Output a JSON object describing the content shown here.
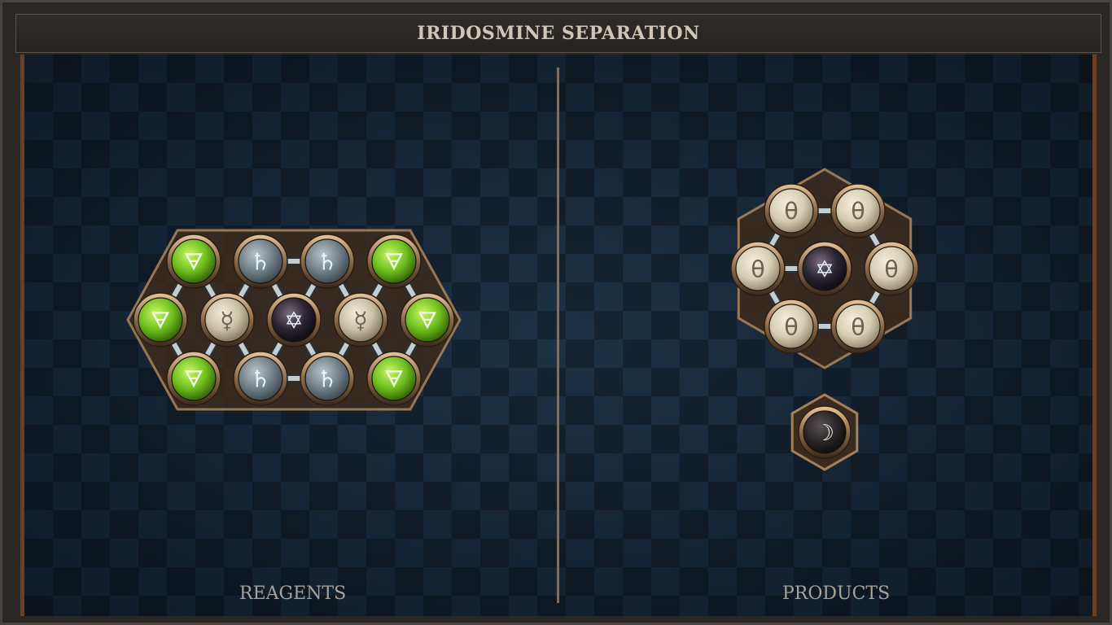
{
  "title": "IRIDOSMINE SEPARATION",
  "panels": {
    "reagents_label": "REAGENTS",
    "products_label": "PRODUCTS"
  },
  "colors": {
    "board": "#142231",
    "frame_accent": "#6b3f24",
    "atom_salt_earth": "#7fd12a",
    "atom_lead": "#8e9ba0",
    "atom_quicksilver": "#d8d0b5",
    "atom_quintessence": "#3a3440",
    "atom_salt": "#e0d8c0",
    "bond": "#b9c3c6"
  },
  "reagent_molecule": {
    "atoms": [
      {
        "id": "r1",
        "element": "earth",
        "glyph": "🜃",
        "col": 0,
        "row": 0
      },
      {
        "id": "r2",
        "element": "lead",
        "glyph": "♄",
        "col": 1,
        "row": 0
      },
      {
        "id": "r3",
        "element": "lead",
        "glyph": "♄",
        "col": 2,
        "row": 0
      },
      {
        "id": "r4",
        "element": "earth",
        "glyph": "🜃",
        "col": 3,
        "row": 0
      },
      {
        "id": "r5",
        "element": "earth",
        "glyph": "🜃",
        "col": 0,
        "row": 1
      },
      {
        "id": "r6",
        "element": "quicksilver",
        "glyph": "☿",
        "col": 1,
        "row": 1
      },
      {
        "id": "r7",
        "element": "aether",
        "glyph": "✡",
        "col": 2,
        "row": 1
      },
      {
        "id": "r8",
        "element": "quicksilver",
        "glyph": "☿",
        "col": 3,
        "row": 1
      },
      {
        "id": "r9",
        "element": "earth",
        "glyph": "🜃",
        "col": 4,
        "row": 1
      },
      {
        "id": "r10",
        "element": "earth",
        "glyph": "🜃",
        "col": 0,
        "row": 2
      },
      {
        "id": "r11",
        "element": "lead",
        "glyph": "♄",
        "col": 1,
        "row": 2
      },
      {
        "id": "r12",
        "element": "lead",
        "glyph": "♄",
        "col": 2,
        "row": 2
      },
      {
        "id": "r13",
        "element": "earth",
        "glyph": "🜃",
        "col": 3,
        "row": 2
      }
    ]
  },
  "product_molecule_1": {
    "atoms": [
      {
        "id": "p1",
        "element": "salt",
        "glyph": "θ"
      },
      {
        "id": "p2",
        "element": "salt",
        "glyph": "θ"
      },
      {
        "id": "p3",
        "element": "salt",
        "glyph": "θ"
      },
      {
        "id": "p4",
        "element": "aether",
        "glyph": "✡"
      },
      {
        "id": "p5",
        "element": "salt",
        "glyph": "θ"
      },
      {
        "id": "p6",
        "element": "salt",
        "glyph": "θ"
      },
      {
        "id": "p7",
        "element": "salt",
        "glyph": "θ"
      }
    ]
  },
  "product_molecule_2": {
    "atoms": [
      {
        "id": "q1",
        "element": "moon",
        "glyph": "☽"
      }
    ]
  }
}
